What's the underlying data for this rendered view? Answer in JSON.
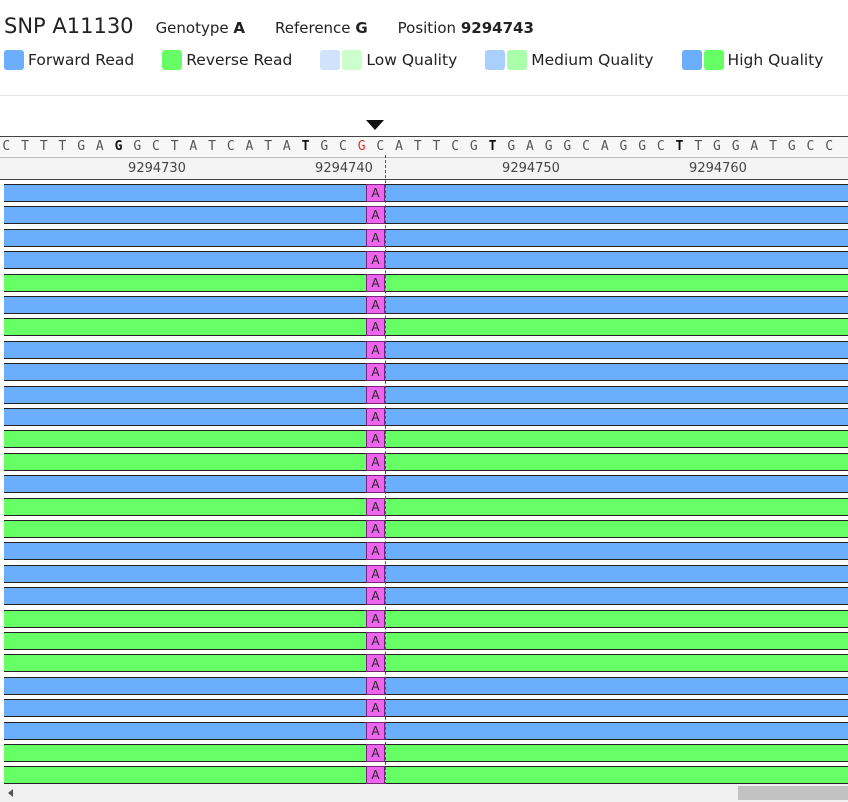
{
  "header": {
    "title": "SNP A11130",
    "genotype_label": "Genotype",
    "genotype_value": "A",
    "reference_label": "Reference",
    "reference_value": "G",
    "position_label": "Position",
    "position_value": "9294743"
  },
  "legend": [
    {
      "label": "Forward Read",
      "colors": [
        "#6aaefc"
      ]
    },
    {
      "label": "Reverse Read",
      "colors": [
        "#66ff66"
      ]
    },
    {
      "label": "Low Quality",
      "colors": [
        "#cfe3fc",
        "#ccffcc"
      ]
    },
    {
      "label": "Medium Quality",
      "colors": [
        "#a9cffc",
        "#aaffaa"
      ]
    },
    {
      "label": "High Quality",
      "colors": [
        "#6aaefc",
        "#66ff66"
      ]
    }
  ],
  "sequence": {
    "bases": [
      "C",
      "T",
      "T",
      "T",
      "G",
      "A",
      "G",
      "G",
      "C",
      "T",
      "A",
      "T",
      "C",
      "A",
      "T",
      "A",
      "T",
      "G",
      "C",
      "G",
      "C",
      "A",
      "T",
      "T",
      "C",
      "G",
      "T",
      "G",
      "A",
      "G",
      "G",
      "C",
      "A",
      "G",
      "G",
      "C",
      "T",
      "T",
      "G",
      "G",
      "A",
      "T",
      "G",
      "C",
      "C"
    ],
    "bold_indices": [
      6,
      16,
      26,
      36
    ],
    "snp_index": 19
  },
  "ruler": {
    "ticks": [
      "9294730",
      "9294740",
      "9294750",
      "9294760"
    ]
  },
  "reads": {
    "allele": "A",
    "strands": [
      "fwd",
      "fwd",
      "fwd",
      "fwd",
      "rev",
      "fwd",
      "rev",
      "fwd",
      "fwd",
      "fwd",
      "fwd",
      "rev",
      "rev",
      "fwd",
      "rev",
      "rev",
      "fwd",
      "fwd",
      "fwd",
      "rev",
      "rev",
      "rev",
      "fwd",
      "fwd",
      "fwd",
      "rev",
      "rev"
    ]
  },
  "colors": {
    "forward": "#6aaefc",
    "reverse": "#66ff66",
    "variant": "#ee66ee",
    "snp_base": "#e03030"
  }
}
